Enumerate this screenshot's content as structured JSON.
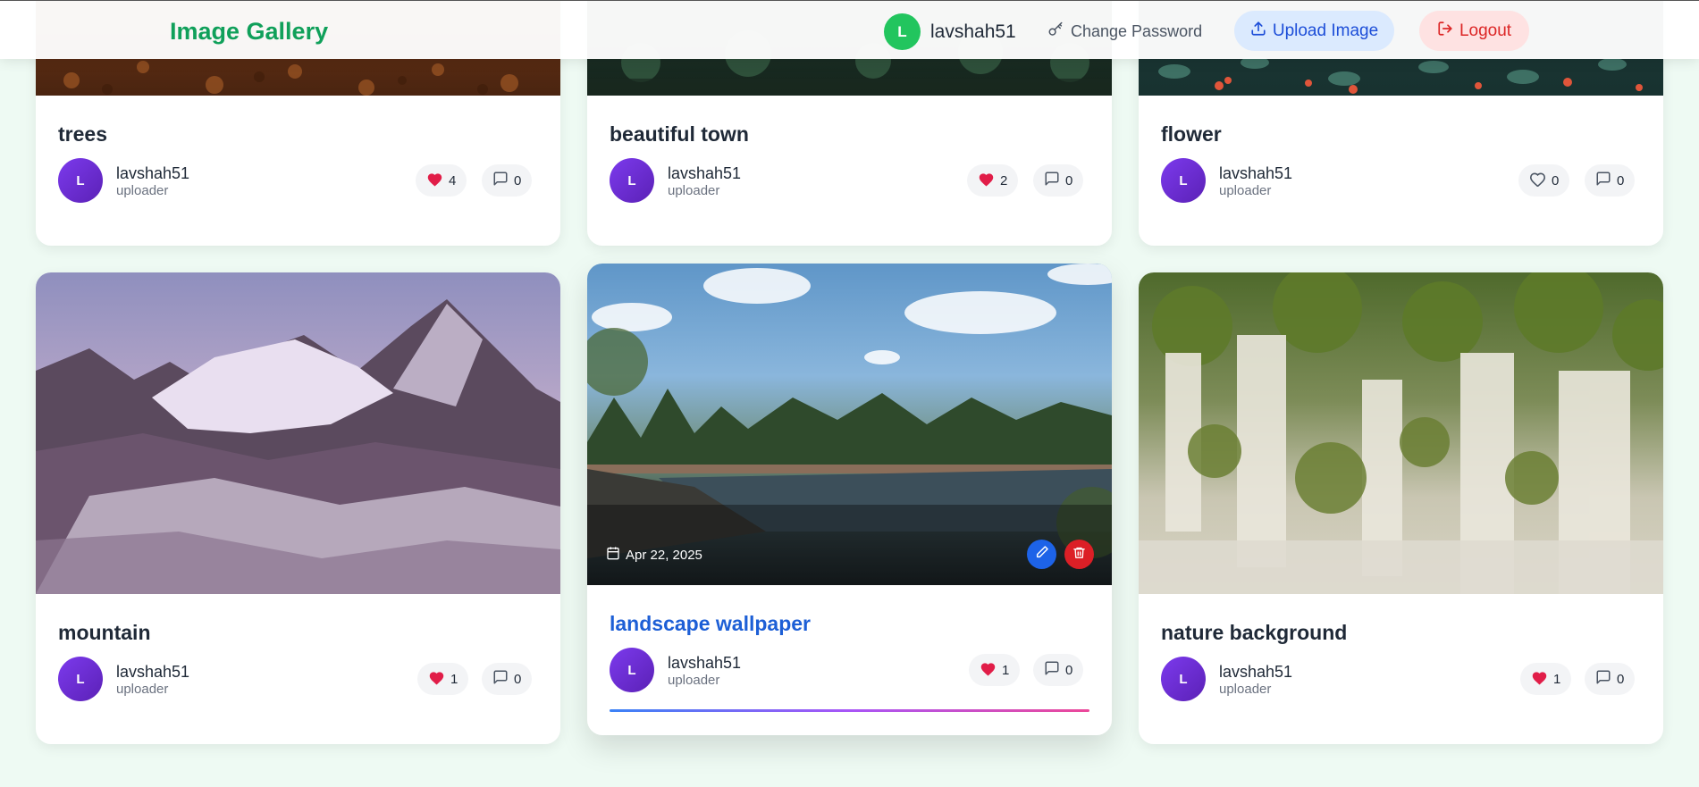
{
  "nav": {
    "brand": "Image Gallery",
    "user_initial": "L",
    "username": "lavshah51",
    "change_password": "Change Password",
    "upload": "Upload Image",
    "logout": "Logout"
  },
  "cards": [
    {
      "title": "trees",
      "initial": "L",
      "user": "lavshah51",
      "role": "uploader",
      "likes": "4",
      "comments": "0",
      "liked": true
    },
    {
      "title": "beautiful town",
      "initial": "L",
      "user": "lavshah51",
      "role": "uploader",
      "likes": "2",
      "comments": "0",
      "liked": true
    },
    {
      "title": "flower",
      "initial": "L",
      "user": "lavshah51",
      "role": "uploader",
      "likes": "0",
      "comments": "0",
      "liked": false
    },
    {
      "title": "mountain",
      "initial": "L",
      "user": "lavshah51",
      "role": "uploader",
      "likes": "1",
      "comments": "0",
      "liked": true
    },
    {
      "title": "landscape wallpaper",
      "initial": "L",
      "user": "lavshah51",
      "role": "uploader",
      "likes": "1",
      "comments": "0",
      "liked": true,
      "date": "Apr 22, 2025"
    },
    {
      "title": "nature background",
      "initial": "L",
      "user": "lavshah51",
      "role": "uploader",
      "likes": "1",
      "comments": "0",
      "liked": true
    }
  ],
  "colors": {
    "brand": "#10a05a",
    "accent_blue": "#1d5fd6",
    "like_red": "#e11d48",
    "danger": "#dc2626",
    "avatar_purple": "#6d28d9"
  }
}
